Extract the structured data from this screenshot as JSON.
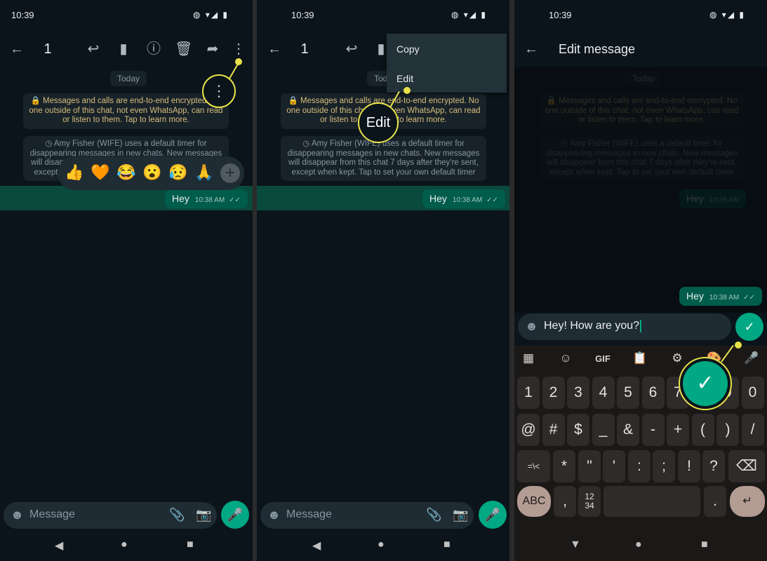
{
  "colors": {
    "accent": "#00a884",
    "bubble": "#005c4b",
    "callout": "#e8e24a",
    "background": "#0b141a"
  },
  "status_bar": {
    "time": "10:39",
    "icons": [
      "vibrate-icon",
      "wifi-icon",
      "signal-icon",
      "battery-icon"
    ]
  },
  "panel1": {
    "toolbar": {
      "selected_count": "1",
      "icons": [
        "back-arrow-icon",
        "reply-icon",
        "star-bookmark-icon",
        "info-icon",
        "delete-icon",
        "forward-icon",
        "more-vert-icon"
      ]
    },
    "date_label": "Today",
    "encryption_notice": "🔒 Messages and calls are end-to-end encrypted. No one outside of this chat, not even WhatsApp, can read or listen to them. Tap to learn more.",
    "timer_notice": "◷ Amy Fisher (WIFE) uses a default timer for disappearing messages in new chats. New messages will disappear from this chat 7 days after they're sent, except when kept. Tap to set your own default timer",
    "reactions": [
      "👍",
      "🧡",
      "😂",
      "😮",
      "😥",
      "🙏",
      "+"
    ],
    "message": {
      "text": "Hey",
      "time": "10:38 AM",
      "ticks": "✓✓"
    },
    "input_placeholder": "Message"
  },
  "panel2": {
    "toolbar": {
      "selected_count": "1"
    },
    "menu": [
      "Copy",
      "Edit"
    ],
    "callout_label": "Edit",
    "date_label": "Today",
    "encryption_notice": "🔒 Messages and calls are end-to-end encrypted. No one outside of this chat, not even WhatsApp, can read or listen to them. Tap to learn more.",
    "timer_notice": "◷ Amy Fisher (WIFE) uses a default timer for disappearing messages in new chats. New messages will disappear from this chat 7 days after they're sent, except when kept. Tap to set your own default timer",
    "message": {
      "text": "Hey",
      "time": "10:38 AM",
      "ticks": "✓✓"
    },
    "input_placeholder": "Message"
  },
  "panel3": {
    "title": "Edit message",
    "date_label": "Today",
    "encryption_notice": "🔒 Messages and calls are end-to-end encrypted. No one outside of this chat, not even WhatsApp, can read or listen to them. Tap to learn more.",
    "timer_notice": "◷ Amy Fisher (WIFE) uses a default timer for disappearing messages in new chats. New messages will disappear from this chat 7 days after they're sent, except when kept. Tap to set your own default timer",
    "message": {
      "text": "Hey",
      "time": "10:38 AM",
      "ticks": "✓✓"
    },
    "input_value": "Hey! How are you?",
    "keyboard": {
      "toolbar": [
        "▦",
        "☺",
        "GIF",
        "📋",
        "⚙",
        "🎨",
        "🎤"
      ],
      "rows": [
        [
          "1",
          "2",
          "3",
          "4",
          "5",
          "6",
          "7",
          "8",
          "9",
          "0"
        ],
        [
          "@",
          "#",
          "$",
          "_",
          "&",
          "-",
          "+",
          "(",
          ")",
          "/"
        ],
        [
          "=\\<",
          "*",
          "\"",
          "'",
          ":",
          ";",
          "!",
          "?",
          "⌫"
        ],
        [
          "ABC",
          ",",
          "12\n34",
          "",
          ".",
          "↵"
        ]
      ]
    }
  }
}
